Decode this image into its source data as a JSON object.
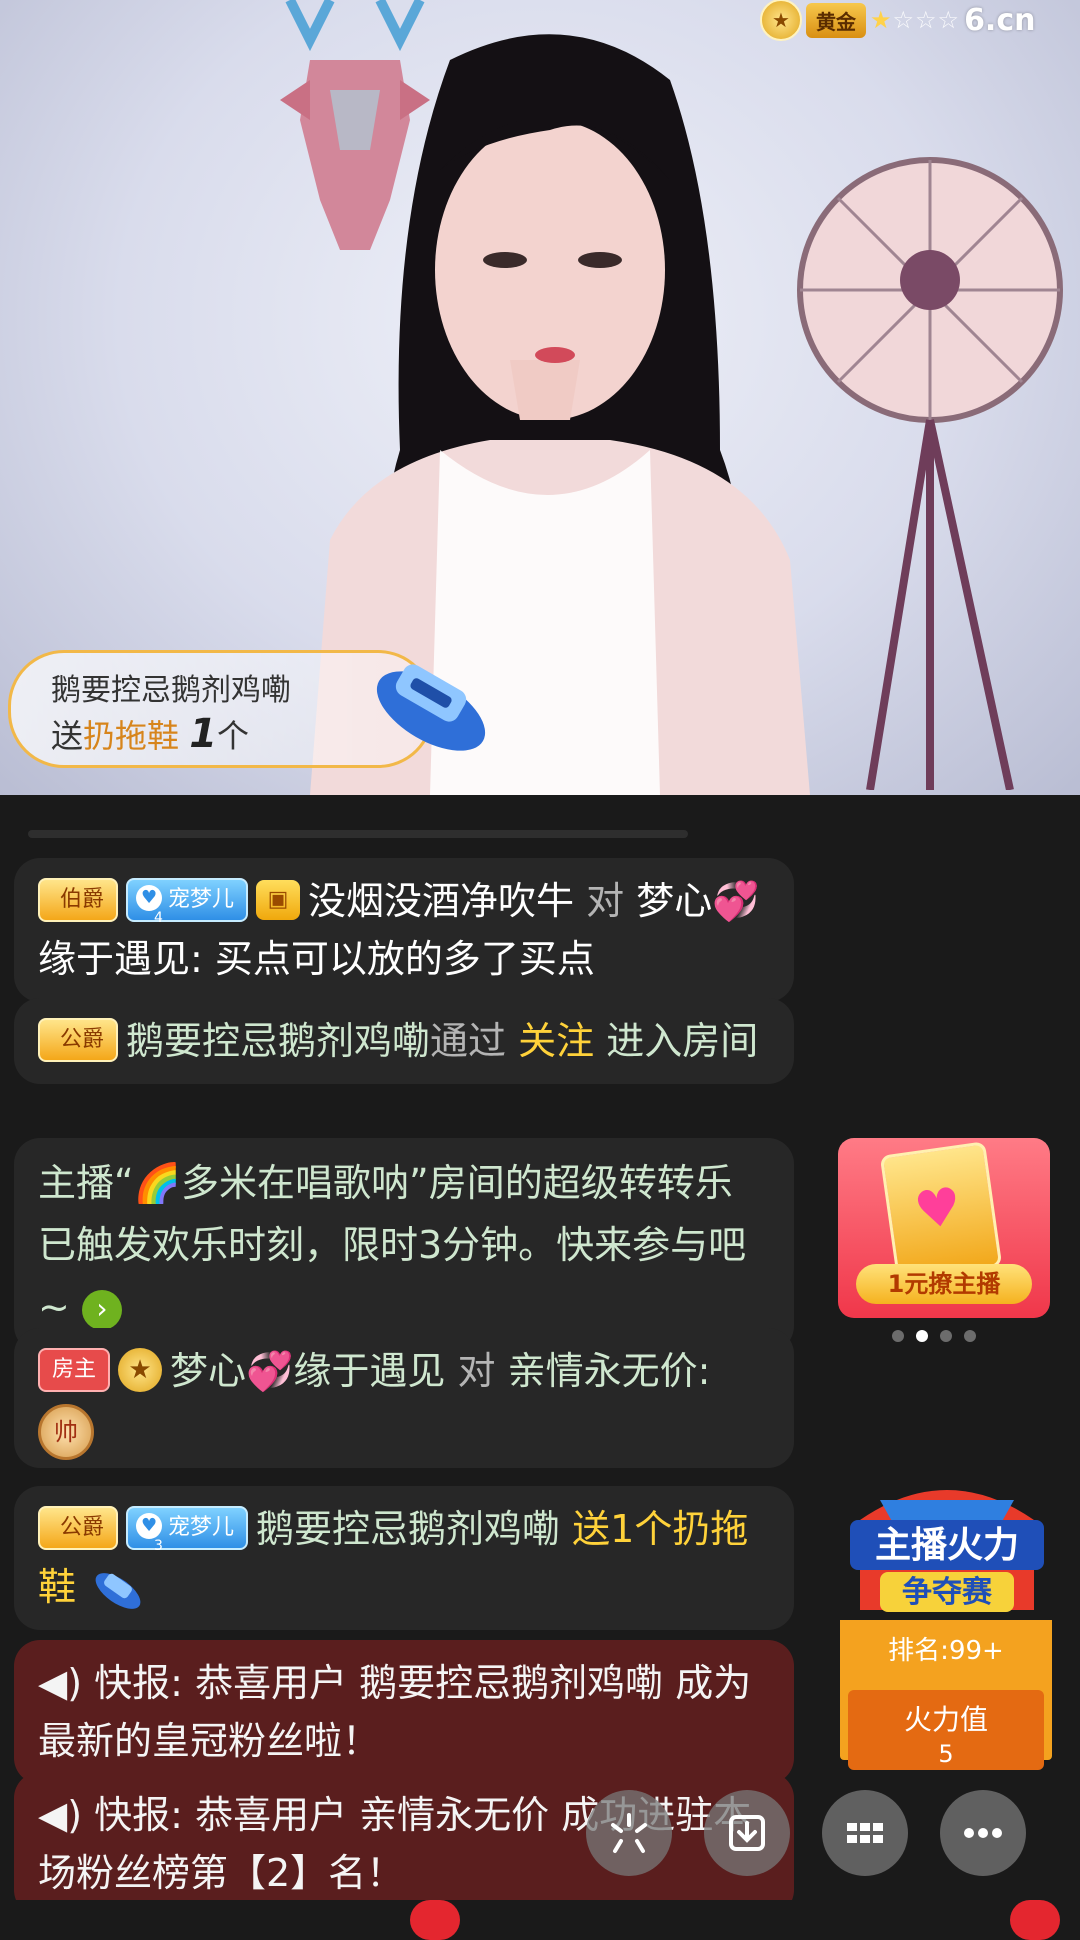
{
  "video": {
    "level_label": "黄金",
    "stars_filled": 1,
    "stars_total": 5,
    "site_logo": "6.cn",
    "gift_banner": {
      "sender": "鹅要控忌鹅剂鸡嘞",
      "action": "送",
      "gift_name": "扔拖鞋",
      "count": "1",
      "unit": "个"
    }
  },
  "chat": [
    {
      "badges": [
        "伯爵",
        "宠梦儿",
        "user-icon"
      ],
      "pet_level": "4",
      "from": "没烟没酒净吹牛",
      "to_word": "对",
      "to": "梦心",
      "heart": "💞",
      "to2": "缘于遇见",
      "text": ": 买点可以放的多了买点"
    },
    {
      "badge": "公爵",
      "user": "鹅要控忌鹅剂鸡嘞",
      "via": "通过",
      "method": "关注",
      "action": "进入房间"
    },
    {
      "prefix": "主播“",
      "rainbow": "🌈",
      "host": "多米在唱歌呐",
      "suffix": "”房间的超级转转乐已触发欢乐时刻，限时3分钟。快来参与吧~"
    },
    {
      "badge": "房主",
      "user": "梦心",
      "heart": "💞",
      "user2": "缘于遇见",
      "to_word": "对",
      "to": "亲情永无价:",
      "chess": "帅"
    },
    {
      "badge": "公爵",
      "pet": "宠梦儿",
      "pet_level": "3",
      "user": "鹅要控忌鹅剂鸡嘞",
      "action": "送1个扔拖鞋"
    },
    {
      "label": "快报:",
      "text": "恭喜用户 鹅要控忌鹅剂鸡嘞 成为最新的皇冠粉丝啦！"
    },
    {
      "label": "快报:",
      "text": "恭喜用户 亲情永无价 成功进驻本场粉丝榜第【2】名！"
    }
  ],
  "promo": {
    "label": "1元撩主播",
    "dots": 4,
    "active_dot": 1
  },
  "fire": {
    "title1": "主播火力",
    "title2": "争夺赛",
    "rank_label": "排名:",
    "rank_value": "99+",
    "value_label": "火力值",
    "value": "5"
  },
  "fabs": [
    "sparkle-icon",
    "download-icon",
    "grid-icon",
    "more-icon"
  ]
}
